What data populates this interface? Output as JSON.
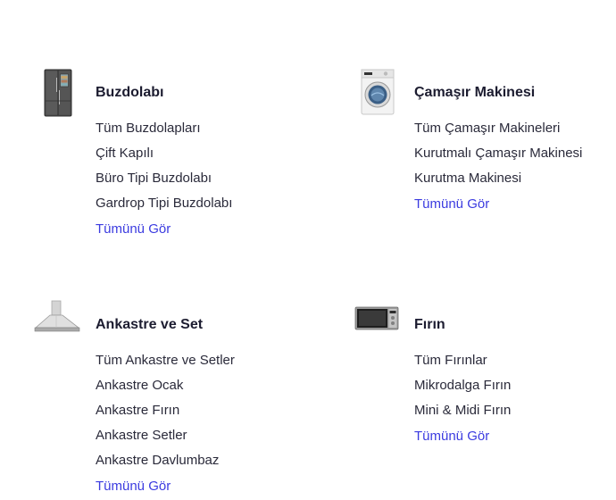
{
  "categories": [
    {
      "id": "buzdolabi",
      "title": "Buzdolabı",
      "icon": "refrigerator-icon",
      "links": [
        "Tüm Buzdolapları",
        "Çift Kapılı",
        "Büro Tipi Buzdolabı",
        "Gardrop Tipi Buzdolabı"
      ],
      "see_all": "Tümünü Gör"
    },
    {
      "id": "camasir",
      "title": "Çamaşır Makinesi",
      "icon": "washing-machine-icon",
      "links": [
        "Tüm Çamaşır Makineleri",
        "Kurutmalı Çamaşır Makinesi",
        "Kurutma Makinesi"
      ],
      "see_all": "Tümünü Gör"
    },
    {
      "id": "ankastre",
      "title": "Ankastre ve Set",
      "icon": "cooker-hood-icon",
      "links": [
        "Tüm Ankastre ve Setler",
        "Ankastre Ocak",
        "Ankastre Fırın",
        "Ankastre Setler",
        "Ankastre Davlumbaz"
      ],
      "see_all": "Tümünü Gör"
    },
    {
      "id": "firin",
      "title": "Fırın",
      "icon": "microwave-oven-icon",
      "links": [
        "Tüm Fırınlar",
        "Mikrodalga Fırın",
        "Mini & Midi Fırın"
      ],
      "see_all": "Tümünü Gör"
    }
  ],
  "colors": {
    "link": "#2a2a3a",
    "see_all": "#3b3be0",
    "title": "#1c1c30"
  }
}
